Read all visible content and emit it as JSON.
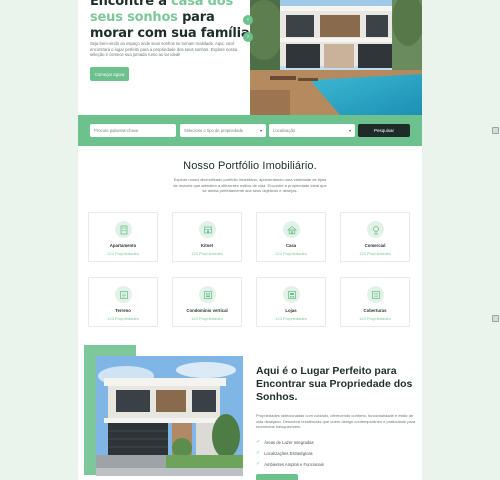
{
  "hero": {
    "title_line1": "Encontre a",
    "title_accent": "casa dos seus sonhos",
    "title_line2": "para morar com sua família.",
    "description": "Seja bem-vindo ao espaço onde seus sonhos se tornam realidade. Aqui, você encontrará o lugar perfeito para a propriedade dos seus sonhos. Explore nossa seleção e comece sua jornada rumo ao lar ideal!",
    "cta_label": "Começar agora",
    "prev_icon": "chevron-left-icon",
    "next_icon": "chevron-right-icon"
  },
  "search": {
    "keyword_placeholder": "Procure palavras-chave",
    "type_placeholder": "Selecione o tipo de propriedade",
    "location_placeholder": "Localização",
    "button_label": "Pesquisar"
  },
  "portfolio": {
    "title": "Nosso Portfólio Imobiliário.",
    "description": "Explore nosso diversificado portfólio imobiliário, apresentando uma variedade de tipos de imóveis que atendem a diferentes estilos de vida. Encontre a propriedade ideal que se alinha perfeitamente aos seus objetivos e desejos.",
    "cards": [
      {
        "name": "Apartamento",
        "count": "123 Propriedades",
        "icon": "apartment-icon"
      },
      {
        "name": "Kitnet",
        "count": "123 Propriedades",
        "icon": "kitnet-icon"
      },
      {
        "name": "Casa",
        "count": "123 Propriedades",
        "icon": "house-icon"
      },
      {
        "name": "Comercial",
        "count": "123 Propriedades",
        "icon": "commercial-icon"
      },
      {
        "name": "Terreno",
        "count": "123 Propriedades",
        "icon": "land-icon"
      },
      {
        "name": "Condominio vertical",
        "count": "123 Propriedades",
        "icon": "condo-icon"
      },
      {
        "name": "Lojas",
        "count": "123 Propriedades",
        "icon": "store-icon"
      },
      {
        "name": "Coberturas",
        "count": "123 Propriedades",
        "icon": "penthouse-icon"
      }
    ]
  },
  "about": {
    "title": "Aqui é o Lugar Perfeito para Encontrar sua Propriedade dos Sonhos.",
    "description": "Propriedades selecionadas com cuidado, oferecendo conforto, funcionalidade e estilo de vida desejado. Descubra residências que unem design contemporâneo e praticidade para momentos inesquecíveis.",
    "features": [
      "Áreas de Lazer Integradas",
      "Localizações Estratégicas",
      "Ambientes Amplos e Funcionais"
    ]
  },
  "colors": {
    "accent": "#6cc18d",
    "accent_light": "#7dc79a",
    "dark": "#1f2b29",
    "background": "#e9f4ec"
  }
}
